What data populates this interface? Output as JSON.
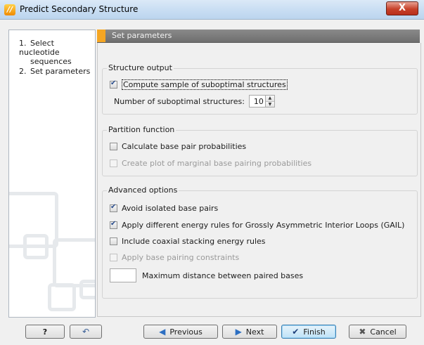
{
  "window": {
    "title": "Predict Secondary Structure",
    "close_label": "X",
    "app_icon_glyph": "///"
  },
  "sidebar": {
    "steps": [
      {
        "num": "1.",
        "label": "Select nucleotide",
        "label2": "sequences"
      },
      {
        "num": "2.",
        "label": "Set parameters"
      }
    ]
  },
  "panel": {
    "header": "Set parameters"
  },
  "structure_output": {
    "legend": "Structure output",
    "compute_label": "Compute sample of suboptimal structures",
    "compute_checked": true,
    "number_label": "Number of suboptimal structures:",
    "number_value": "10"
  },
  "partition_function": {
    "legend": "Partition function",
    "calc_label": "Calculate base pair probabilities",
    "calc_checked": false,
    "plot_label": "Create plot of marginal base pairing probabilities",
    "plot_enabled": false
  },
  "advanced": {
    "legend": "Advanced options",
    "avoid_label": "Avoid isolated base pairs",
    "avoid_checked": true,
    "gail_label": "Apply different energy rules for Grossly Asymmetric Interior Loops (GAIL)",
    "gail_checked": true,
    "coaxial_label": "Include coaxial stacking energy rules",
    "coaxial_checked": false,
    "constraints_label": "Apply base pairing constraints",
    "constraints_enabled": false,
    "max_distance_label": "Maximum distance between paired bases",
    "max_distance_value": ""
  },
  "footer": {
    "help_label": "?",
    "previous_label": "Previous",
    "next_label": "Next",
    "finish_label": "Finish",
    "cancel_label": "Cancel"
  }
}
